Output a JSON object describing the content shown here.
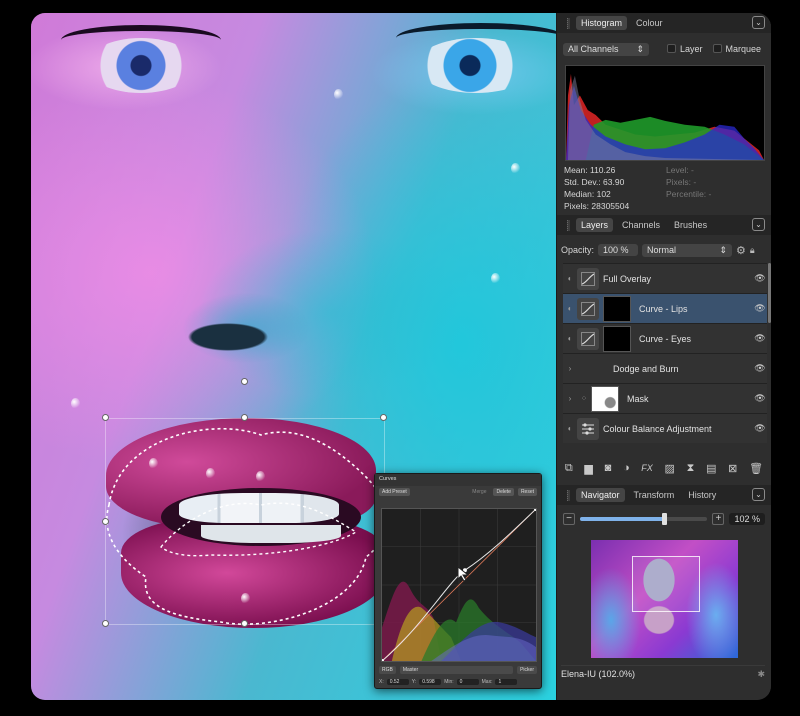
{
  "histogram_panel": {
    "tabs": [
      "Histogram",
      "Colour"
    ],
    "channel_select": "All Channels",
    "layer_label": "Layer",
    "marquee_label": "Marquee",
    "stats_left": [
      "Mean: 110.26",
      "Std. Dev.: 63.90",
      "Median: 102",
      "Pixels: 28305504"
    ],
    "stats_right": [
      "Level: -",
      "Pixels: -",
      "Percentile: -"
    ]
  },
  "layers_panel": {
    "tabs": [
      "Layers",
      "Channels",
      "Brushes"
    ],
    "opacity_label": "Opacity:",
    "opacity_value": "100 %",
    "blend_mode": "Normal",
    "layers": [
      {
        "name": "Full Overlay"
      },
      {
        "name": "Curve - Lips"
      },
      {
        "name": "Curve - Eyes"
      },
      {
        "name": "Dodge and Burn"
      },
      {
        "name": "Mask"
      },
      {
        "name": "Colour Balance Adjustment"
      }
    ]
  },
  "navigator_panel": {
    "tabs": [
      "Navigator",
      "Transform",
      "History"
    ],
    "zoom_value": "102 %",
    "zoom_fraction": 0.66,
    "document_label": "Elena-IU (102.0%)"
  },
  "curves_dialog": {
    "title": "Curves",
    "add_preset": "Add Preset",
    "merge": "Merge",
    "delete": "Delete",
    "reset": "Reset",
    "colour_space": "RGB",
    "channel": "Master",
    "picker": "Picker",
    "x_label": "X:",
    "x_value": "0.52",
    "y_label": "Y:",
    "y_value": "0.598",
    "min_label": "Min:",
    "min_value": "0",
    "max_label": "Max:",
    "max_value": "1"
  },
  "colors": {
    "panel_bg": "#2e2e2e",
    "selected_layer": "#3a526e",
    "accent": "#7fb2ea"
  },
  "icons": [
    "chevron-down-icon",
    "gear-icon",
    "lock-icon",
    "eye-icon",
    "trash-icon",
    "fx-icon",
    "cursor-icon"
  ]
}
